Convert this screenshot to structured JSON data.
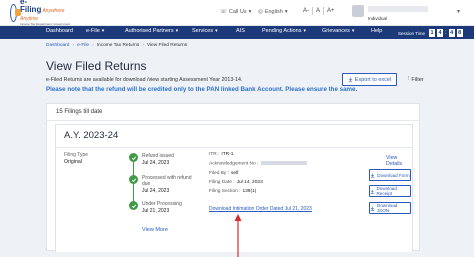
{
  "header": {
    "logo_title": "e-Filing",
    "logo_tagline": "Anywhere Anytime",
    "logo_sub": "Income Tax Department, Government of India",
    "call_label": "Call Us",
    "language": "English",
    "text_size": [
      "A-",
      "A",
      "A+"
    ],
    "user_name": "Individual"
  },
  "nav": {
    "items": [
      "Dashboard",
      "e-File",
      "Authorised Partners",
      "Services",
      "AIS",
      "Pending Actions",
      "Grievances",
      "Help"
    ],
    "session_label": "Session Time",
    "session_digits": [
      "1",
      "4",
      "4",
      "8"
    ]
  },
  "breadcrumb": [
    "Dashboard",
    "e-File",
    "Income Tax Returns",
    "View Filed Returns"
  ],
  "page": {
    "title": "View Filed Returns",
    "subtitle": "e-Filed Returns are available for download /view starting Assessment Year 2013-14.",
    "notice": "Please note that the refund will be credited only to the PAN linked Bank Account. Please ensure the same.",
    "export_label": "Export to excel",
    "filter_label": "Filter"
  },
  "filings": {
    "count_label": "15 Filings till date",
    "ay": "A.Y. 2023-24",
    "filing_type_label": "Filing Type",
    "filing_type_value": "Original",
    "timeline": [
      {
        "label": "Refund issued",
        "date": "Jul 24, 2023"
      },
      {
        "label": "Processed with refund due",
        "date": "Jul 24, 2023"
      },
      {
        "label": "Under Processing",
        "date": "Jul 21, 2023"
      }
    ],
    "view_more": "View More",
    "meta": {
      "itr_label": "ITR :",
      "itr_value": "ITR-1",
      "ack_label": "Acknowledgement No :",
      "filed_by_label": "Filed By :",
      "filed_by_value": "self",
      "filing_date_label": "Filing Date :",
      "filing_date_value": "Jul 14, 2023",
      "filing_section_label": "Filing Section :",
      "filing_section_value": "139(1)"
    },
    "download_link": "Download Intimation Order Dated Jul 21, 2023",
    "view_details": "View Details",
    "buttons": [
      "Download Form",
      "Download Receipt",
      "Download JSON"
    ]
  },
  "colors": {
    "nav_bg": "#1c3a7a",
    "link": "#2b5bbd",
    "notice": "#2d72c8",
    "success": "#3f9b46",
    "annotation_arrow": "#d32f2f"
  }
}
